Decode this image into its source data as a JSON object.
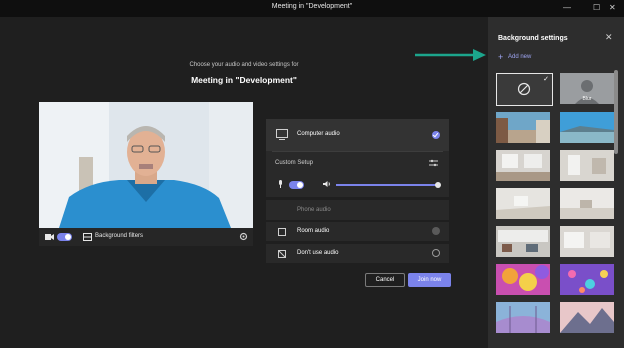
{
  "window": {
    "title": "Meeting in \"Development\"",
    "minimize": "—",
    "maximize": "☐",
    "close": "✕"
  },
  "prejoin": {
    "subtitle": "Choose your audio and video settings for",
    "meeting_title": "Meeting in \"Development\"",
    "camera_on": true,
    "background_filters_label": "Background filters"
  },
  "audio": {
    "computer_audio": "Computer audio",
    "custom_setup": "Custom Setup",
    "mic_on": true,
    "speaker_volume": 1.0,
    "phone_audio": "Phone audio",
    "room_audio": "Room audio",
    "dont_use_audio": "Don't use audio",
    "selected": "computer_audio"
  },
  "actions": {
    "cancel": "Cancel",
    "join_now": "Join now"
  },
  "background_settings": {
    "title": "Background settings",
    "add_new": "Add new",
    "blur_label": "Blur",
    "selected": "none"
  },
  "colors": {
    "accent": "#7b83eb",
    "teal_arrow": "#1ca58c"
  }
}
